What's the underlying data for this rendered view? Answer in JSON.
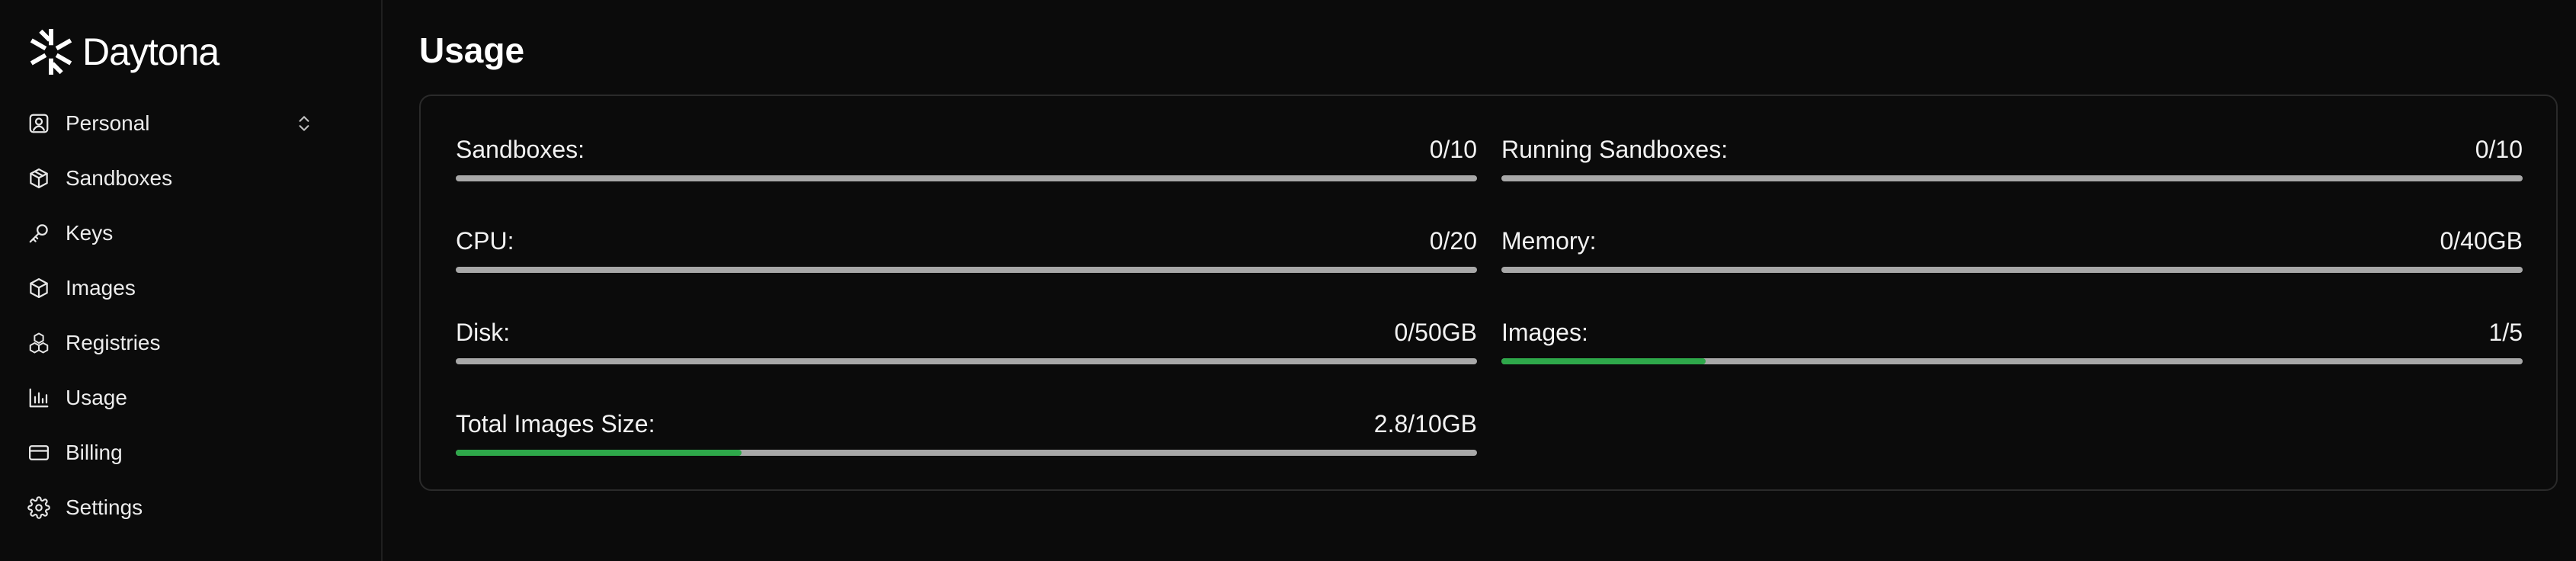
{
  "brand": {
    "name": "Daytona",
    "icon": "daytona-logo-icon"
  },
  "sidebar": {
    "items": [
      {
        "label": "Personal",
        "icon": "user-square-icon",
        "has_chevron": true
      },
      {
        "label": "Sandboxes",
        "icon": "box-icon"
      },
      {
        "label": "Keys",
        "icon": "key-icon"
      },
      {
        "label": "Images",
        "icon": "package-icon"
      },
      {
        "label": "Registries",
        "icon": "boxes-icon"
      },
      {
        "label": "Usage",
        "icon": "bar-chart-icon"
      },
      {
        "label": "Billing",
        "icon": "credit-card-icon"
      },
      {
        "label": "Settings",
        "icon": "gear-icon"
      }
    ]
  },
  "page": {
    "title": "Usage"
  },
  "metrics": [
    {
      "label": "Sandboxes:",
      "value": "0/10",
      "fraction": 0
    },
    {
      "label": "Running Sandboxes:",
      "value": "0/10",
      "fraction": 0
    },
    {
      "label": "CPU:",
      "value": "0/20",
      "fraction": 0
    },
    {
      "label": "Memory:",
      "value": "0/40GB",
      "fraction": 0
    },
    {
      "label": "Disk:",
      "value": "0/50GB",
      "fraction": 0
    },
    {
      "label": "Images:",
      "value": "1/5",
      "fraction": 0.2
    },
    {
      "label": "Total Images Size:",
      "value": "2.8/10GB",
      "fraction": 0.28
    }
  ],
  "colors": {
    "bar_track": "#a8a8a8",
    "bar_fill": "#2ea84a",
    "background": "#0b0b0b"
  }
}
